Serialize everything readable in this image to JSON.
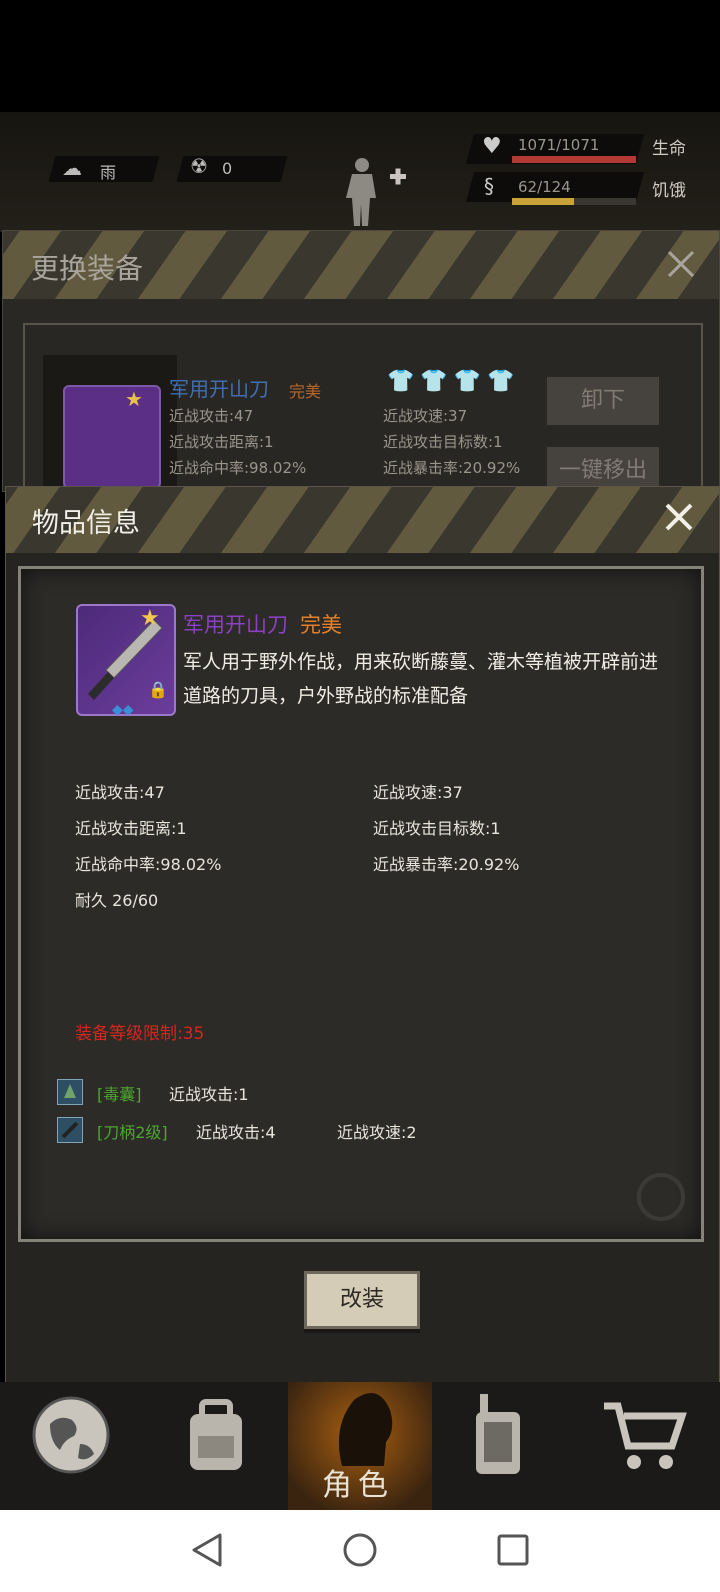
{
  "hud": {
    "weather": "雨",
    "radiation": "0",
    "health": "1071/1071",
    "health_label": "生命",
    "health_ratio": 1.0,
    "hunger": "62/124",
    "hunger_label": "饥饿",
    "hunger_ratio": 0.5
  },
  "equip_panel": {
    "title": "更换装备",
    "item_name": "军用开山刀",
    "item_quality": "完美",
    "stats_left": [
      "近战攻击:47",
      "近战攻击距离:1",
      "近战命中率:98.02%"
    ],
    "stats_right": [
      "近战攻速:37",
      "近战攻击目标数:1",
      "近战暴击率:20.92%"
    ],
    "unequip_label": "卸下",
    "move_out_label": "一键移出"
  },
  "item_info": {
    "title": "物品信息",
    "item_name": "军用开山刀",
    "item_quality": "完美",
    "description": "军人用于野外作战，用来砍断藤蔓、灌木等植被开辟前进道路的刀具，户外野战的标准配备",
    "stats": {
      "melee_attack": "近战攻击:47",
      "melee_speed": "近战攻速:37",
      "melee_range": "近战攻击距离:1",
      "melee_targets": "近战攻击目标数:1",
      "melee_hit": "近战命中率:98.02%",
      "melee_crit": "近战暴击率:20.92%",
      "durability": "耐久 26/60"
    },
    "level_limit": "装备等级限制:35",
    "mods": [
      {
        "name": "[毒囊]",
        "effects": [
          "近战攻击:1"
        ]
      },
      {
        "name": "[刀柄2级]",
        "effects": [
          "近战攻击:4",
          "近战攻速:2"
        ]
      }
    ],
    "modify_label": "改装"
  },
  "nav": {
    "active_label": "角色"
  },
  "colors": {
    "item_name": "#8b3fc2",
    "quality": "#e3812a",
    "level_limit": "#d8261e",
    "mod_name": "#4ca62f",
    "health_bar": "#b13a34",
    "hunger_bar": "#c9a23a"
  }
}
